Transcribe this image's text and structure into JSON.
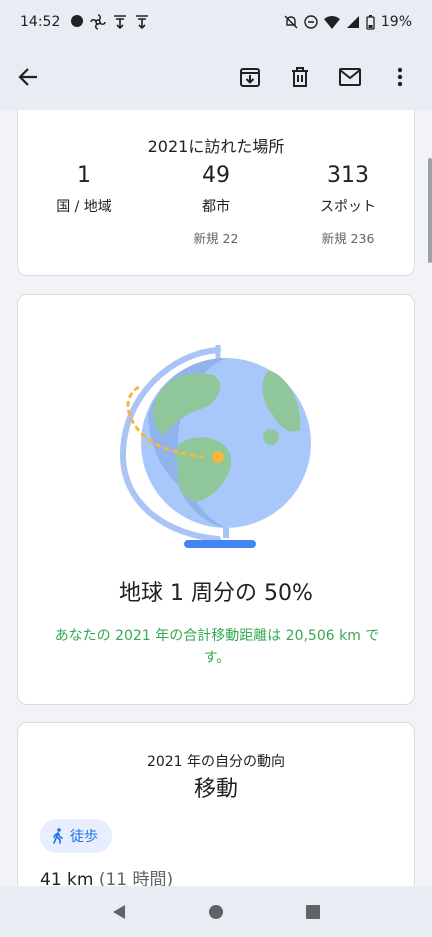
{
  "status_bar": {
    "time": "14:52",
    "battery": "19%"
  },
  "places_card": {
    "title": "2021に訪れた場所",
    "stats": [
      {
        "number": "1",
        "label": "国 / 地域",
        "new": ""
      },
      {
        "number": "49",
        "label": "都市",
        "new": "新規 22"
      },
      {
        "number": "313",
        "label": "スポット",
        "new": "新規 236"
      }
    ]
  },
  "globe_card": {
    "title": "地球 1 周分の 50%",
    "description": "あなたの 2021 年の合計移動距離は 20,506 km です。",
    "progress_fraction": 0.5
  },
  "movement_card": {
    "subtitle": "2021 年の自分の動向",
    "title": "移動",
    "chip_label": "徒歩",
    "distance": "41 km",
    "duration": "(11 時間)"
  },
  "icons": {
    "back": "arrow-left-icon",
    "archive": "archive-icon",
    "delete": "trash-icon",
    "mail": "mail-icon",
    "more": "more-vert-icon"
  }
}
